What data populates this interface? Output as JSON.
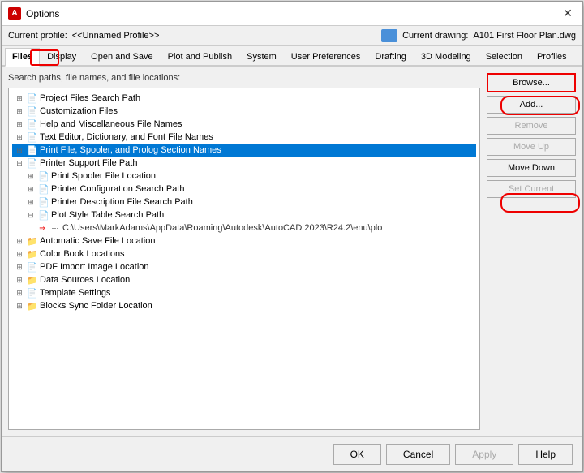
{
  "window": {
    "title": "Options",
    "close_label": "✕"
  },
  "profile_bar": {
    "current_profile_label": "Current profile:",
    "current_profile_value": "<<Unnamed Profile>>",
    "current_drawing_label": "Current drawing:",
    "current_drawing_value": "A101 First Floor Plan.dwg"
  },
  "tabs": [
    {
      "id": "files",
      "label": "Files",
      "active": true
    },
    {
      "id": "display",
      "label": "Display",
      "active": false
    },
    {
      "id": "open-save",
      "label": "Open and Save",
      "active": false
    },
    {
      "id": "plot-publish",
      "label": "Plot and Publish",
      "active": false
    },
    {
      "id": "system",
      "label": "System",
      "active": false
    },
    {
      "id": "user-prefs",
      "label": "User Preferences",
      "active": false
    },
    {
      "id": "drafting",
      "label": "Drafting",
      "active": false
    },
    {
      "id": "3d-modeling",
      "label": "3D Modeling",
      "active": false
    },
    {
      "id": "selection",
      "label": "Selection",
      "active": false
    },
    {
      "id": "profiles",
      "label": "Profiles",
      "active": false
    }
  ],
  "panel": {
    "label": "Search paths, file names, and file locations:"
  },
  "tree": {
    "items": [
      {
        "id": "project-files",
        "indent": 0,
        "expanded": false,
        "icon": "doc",
        "label": "Project Files Search Path"
      },
      {
        "id": "customization",
        "indent": 0,
        "expanded": false,
        "icon": "doc",
        "label": "Customization Files"
      },
      {
        "id": "help-misc",
        "indent": 0,
        "expanded": false,
        "icon": "doc",
        "label": "Help and Miscellaneous File Names"
      },
      {
        "id": "text-editor",
        "indent": 0,
        "expanded": false,
        "icon": "doc",
        "label": "Text Editor, Dictionary, and Font File Names"
      },
      {
        "id": "print-file",
        "indent": 0,
        "expanded": false,
        "icon": "doc",
        "label": "Print File, Spooler, and Prolog Section Names",
        "selected": true
      },
      {
        "id": "printer-support",
        "indent": 0,
        "expanded": true,
        "icon": "doc",
        "label": "Printer Support File Path"
      },
      {
        "id": "print-spooler",
        "indent": 1,
        "expanded": false,
        "icon": "doc",
        "label": "Print Spooler File Location"
      },
      {
        "id": "printer-config",
        "indent": 1,
        "expanded": false,
        "icon": "doc",
        "label": "Printer Configuration Search Path"
      },
      {
        "id": "printer-desc",
        "indent": 1,
        "expanded": false,
        "icon": "doc",
        "label": "Printer Description File Search Path"
      },
      {
        "id": "plot-style",
        "indent": 1,
        "expanded": true,
        "icon": "doc",
        "label": "Plot Style Table Search Path"
      },
      {
        "id": "plot-path-value",
        "indent": 2,
        "expanded": false,
        "icon": "path",
        "label": "C:\\Users\\MarkAdams\\AppData\\Roaming\\Autodesk\\AutoCAD 2023\\R24.2\\enu\\plo"
      },
      {
        "id": "auto-save",
        "indent": 0,
        "expanded": false,
        "icon": "folder",
        "label": "Automatic Save File Location"
      },
      {
        "id": "color-book",
        "indent": 0,
        "expanded": false,
        "icon": "folder",
        "label": "Color Book Locations"
      },
      {
        "id": "pdf-import",
        "indent": 0,
        "expanded": false,
        "icon": "doc",
        "label": "PDF Import Image Location"
      },
      {
        "id": "data-sources",
        "indent": 0,
        "expanded": false,
        "icon": "folder",
        "label": "Data Sources Location"
      },
      {
        "id": "template",
        "indent": 0,
        "expanded": false,
        "icon": "doc",
        "label": "Template Settings"
      },
      {
        "id": "blocks-sync",
        "indent": 0,
        "expanded": false,
        "icon": "folder",
        "label": "Blocks Sync Folder Location"
      }
    ]
  },
  "buttons": {
    "browse": "Browse...",
    "add": "Add...",
    "remove": "Remove",
    "move_up": "Move Up",
    "move_down": "Move Down",
    "set_current": "Set Current"
  },
  "footer": {
    "ok": "OK",
    "cancel": "Cancel",
    "apply": "Apply",
    "help": "Help"
  }
}
